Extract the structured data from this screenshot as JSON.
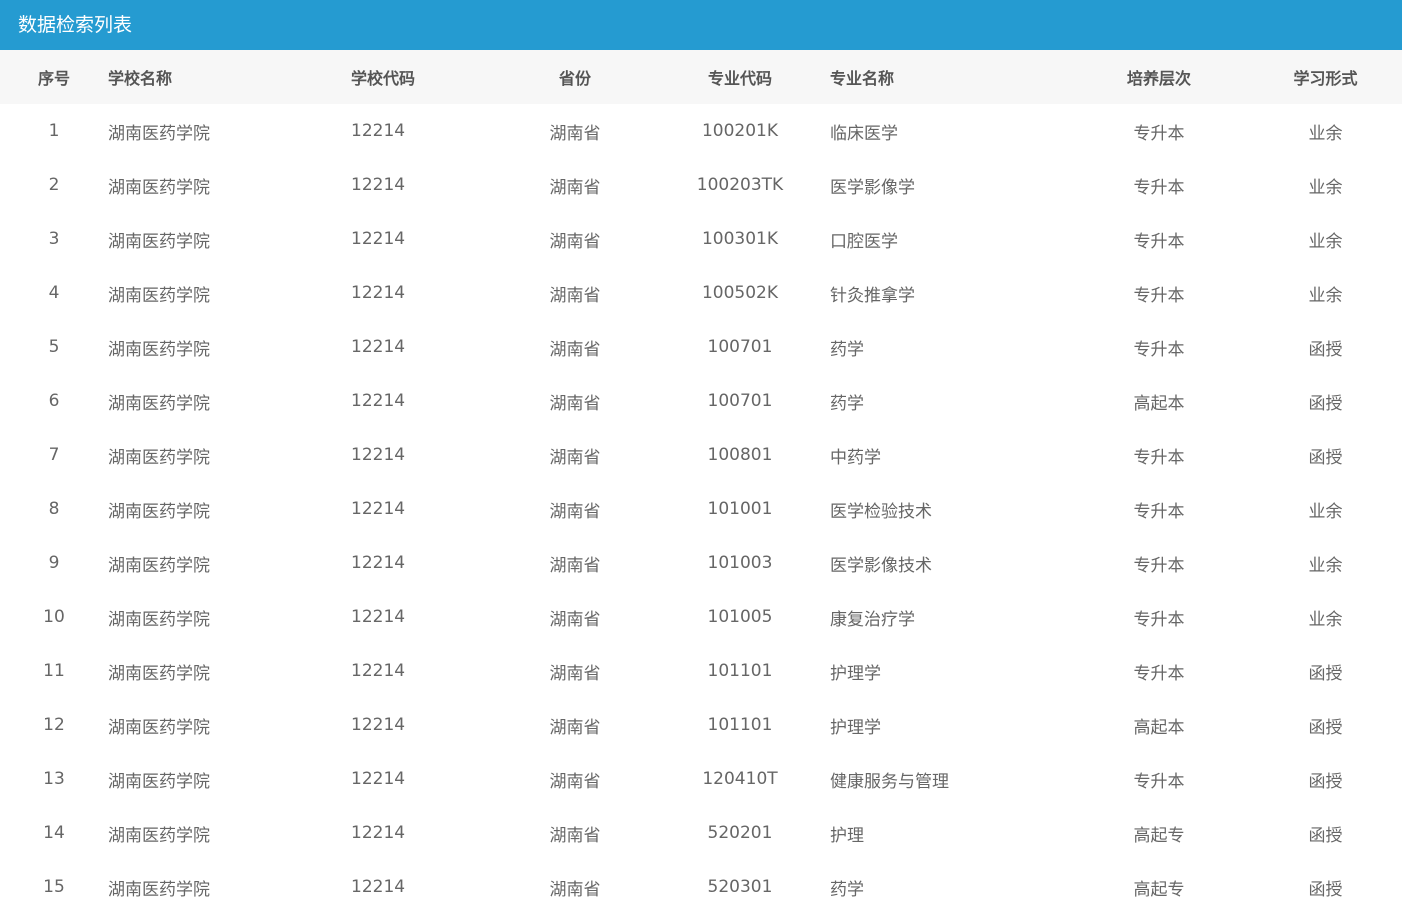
{
  "header": {
    "title": "数据检索列表"
  },
  "table": {
    "columns": [
      "序号",
      "学校名称",
      "学校代码",
      "省份",
      "专业代码",
      "专业名称",
      "培养层次",
      "学习形式"
    ],
    "rows": [
      [
        "1",
        "湖南医药学院",
        "12214",
        "湖南省",
        "100201K",
        "临床医学",
        "专升本",
        "业余"
      ],
      [
        "2",
        "湖南医药学院",
        "12214",
        "湖南省",
        "100203TK",
        "医学影像学",
        "专升本",
        "业余"
      ],
      [
        "3",
        "湖南医药学院",
        "12214",
        "湖南省",
        "100301K",
        "口腔医学",
        "专升本",
        "业余"
      ],
      [
        "4",
        "湖南医药学院",
        "12214",
        "湖南省",
        "100502K",
        "针灸推拿学",
        "专升本",
        "业余"
      ],
      [
        "5",
        "湖南医药学院",
        "12214",
        "湖南省",
        "100701",
        "药学",
        "专升本",
        "函授"
      ],
      [
        "6",
        "湖南医药学院",
        "12214",
        "湖南省",
        "100701",
        "药学",
        "高起本",
        "函授"
      ],
      [
        "7",
        "湖南医药学院",
        "12214",
        "湖南省",
        "100801",
        "中药学",
        "专升本",
        "函授"
      ],
      [
        "8",
        "湖南医药学院",
        "12214",
        "湖南省",
        "101001",
        "医学检验技术",
        "专升本",
        "业余"
      ],
      [
        "9",
        "湖南医药学院",
        "12214",
        "湖南省",
        "101003",
        "医学影像技术",
        "专升本",
        "业余"
      ],
      [
        "10",
        "湖南医药学院",
        "12214",
        "湖南省",
        "101005",
        "康复治疗学",
        "专升本",
        "业余"
      ],
      [
        "11",
        "湖南医药学院",
        "12214",
        "湖南省",
        "101101",
        "护理学",
        "专升本",
        "函授"
      ],
      [
        "12",
        "湖南医药学院",
        "12214",
        "湖南省",
        "101101",
        "护理学",
        "高起本",
        "函授"
      ],
      [
        "13",
        "湖南医药学院",
        "12214",
        "湖南省",
        "120410T",
        "健康服务与管理",
        "专升本",
        "函授"
      ],
      [
        "14",
        "湖南医药学院",
        "12214",
        "湖南省",
        "520201",
        "护理",
        "高起专",
        "函授"
      ],
      [
        "15",
        "湖南医药学院",
        "12214",
        "湖南省",
        "520301",
        "药学",
        "高起专",
        "函授"
      ]
    ]
  },
  "colors": {
    "header_bar": "#259bd1",
    "table_head_bg": "#f7f7f7",
    "text": "#666666"
  }
}
